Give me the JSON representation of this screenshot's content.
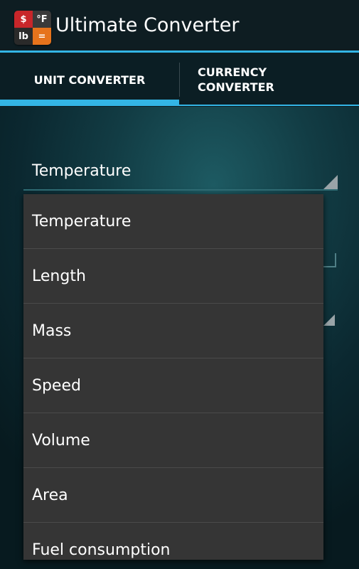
{
  "app": {
    "title": "Ultimate Converter",
    "icon": {
      "name": "ultimate-converter-app-icon",
      "quadrants": [
        "$",
        "°F",
        "lb",
        "="
      ]
    }
  },
  "tabs": [
    {
      "label": "UNIT CONVERTER",
      "selected": true
    },
    {
      "label": "CURRENCY CONVERTER",
      "selected": false
    }
  ],
  "spinner": {
    "selected": "Temperature"
  },
  "dropdown": {
    "options": [
      "Temperature",
      "Length",
      "Mass",
      "Speed",
      "Volume",
      "Area",
      "Fuel consumption"
    ]
  },
  "colors": {
    "accent": "#33b5e5",
    "dropdown_background": "#353535",
    "actionbar_background": "#0e1d22"
  }
}
